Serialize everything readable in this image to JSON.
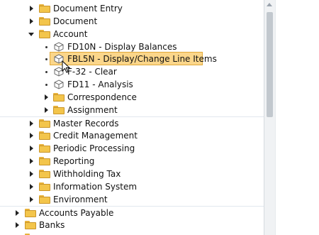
{
  "tree": {
    "document_entry": "Document Entry",
    "document": "Document",
    "account": "Account",
    "fd10n": "FD10N - Display Balances",
    "fbl5n": "FBL5N - Display/Change Line Items",
    "f32": "F-32 - Clear",
    "fd11": "FD11 - Analysis",
    "correspondence": "Correspondence",
    "assignment": "Assignment",
    "master_records": "Master Records",
    "credit_management": "Credit Management",
    "periodic_processing": "Periodic Processing",
    "reporting": "Reporting",
    "withholding_tax": "Withholding Tax",
    "information_system": "Information System",
    "environment": "Environment",
    "accounts_payable": "Accounts Payable",
    "banks": "Banks"
  },
  "colors": {
    "highlight": "#fbd68a",
    "folder": "#f3c54b"
  }
}
